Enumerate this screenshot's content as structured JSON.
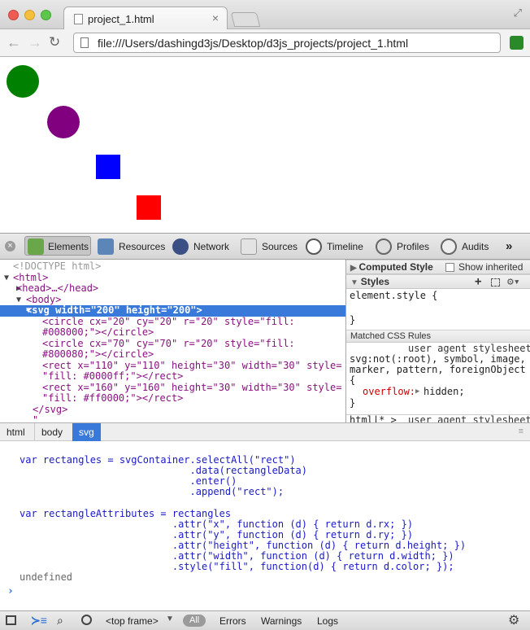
{
  "browser": {
    "tab_title": "project_1.html",
    "tab_close": "×",
    "url": "file:///Users/dashingd3js/Desktop/d3js_projects/project_1.html"
  },
  "page_shapes": [
    {
      "kind": "circle",
      "fill": "#008000"
    },
    {
      "kind": "circle",
      "fill": "#800080"
    },
    {
      "kind": "rect",
      "fill": "#0000ff"
    },
    {
      "kind": "rect",
      "fill": "#ff0000"
    }
  ],
  "devtools": {
    "tabs": [
      "Elements",
      "Resources",
      "Network",
      "Sources",
      "Timeline",
      "Profiles",
      "Audits"
    ],
    "more": "»",
    "elements_lines": [
      {
        "tri": "",
        "text": "<!DOCTYPE html>",
        "kind": "doctype"
      },
      {
        "tri": "▼",
        "text": "<html>",
        "kind": "tag"
      },
      {
        "tri": "▶",
        "text": "<head>…</head>",
        "kind": "tag"
      },
      {
        "tri": "▼",
        "text": "<body>",
        "kind": "tag"
      },
      {
        "tri": "▼",
        "text": "<svg width=\"200\" height=\"200\">",
        "kind": "selected"
      },
      {
        "tri": "",
        "text": "<circle cx=\"20\" cy=\"20\" r=\"20\" style=\"fill:",
        "kind": "tag"
      },
      {
        "tri": "",
        "text": "#008000;\"></circle>",
        "kind": "tag"
      },
      {
        "tri": "",
        "text": "<circle cx=\"70\" cy=\"70\" r=\"20\" style=\"fill:",
        "kind": "tag"
      },
      {
        "tri": "",
        "text": "#800080;\"></circle>",
        "kind": "tag"
      },
      {
        "tri": "",
        "text": "<rect x=\"110\" y=\"110\" height=\"30\" width=\"30\" style=",
        "kind": "tag"
      },
      {
        "tri": "",
        "text": "\"fill: #0000ff;\"></rect>",
        "kind": "tag"
      },
      {
        "tri": "",
        "text": "<rect x=\"160\" y=\"160\" height=\"30\" width=\"30\" style=",
        "kind": "tag"
      },
      {
        "tri": "",
        "text": "\"fill: #ff0000;\"></rect>",
        "kind": "tag"
      },
      {
        "tri": "",
        "text": "</svg>",
        "kind": "tag"
      },
      {
        "tri": "",
        "text": "\"",
        "kind": "tag"
      }
    ],
    "sidebar": {
      "computed_style": "Computed Style",
      "show_inherited": "Show inherited",
      "styles": "Styles",
      "element_style": "element.style {",
      "element_style_close": "}",
      "matched_rules": "Matched CSS Rules",
      "ua_stylesheet": "user agent stylesheet",
      "selector_1": "svg:not(:root), symbol, image,",
      "selector_2": "marker, pattern, foreignObject",
      "brace_open": "{",
      "overflow_prop": "overflow:",
      "overflow_val": "hidden;",
      "brace_close": "}",
      "next_rule": "html|* >",
      "next_rule_ua": "user agent stylesheet"
    },
    "breadcrumbs": [
      "html",
      "body",
      "svg"
    ],
    "console_lines": [
      {
        "text": "var rectangles = svgContainer.selectAll(\"rect\")",
        "type": "in"
      },
      {
        "text": "                             .data(rectangleData)",
        "type": "in"
      },
      {
        "text": "                             .enter()",
        "type": "in"
      },
      {
        "text": "                             .append(\"rect\");",
        "type": "in"
      },
      {
        "text": "",
        "type": "in"
      },
      {
        "text": "var rectangleAttributes = rectangles",
        "type": "in"
      },
      {
        "text": "                          .attr(\"x\", function (d) { return d.rx; })",
        "type": "in"
      },
      {
        "text": "                          .attr(\"y\", function (d) { return d.ry; })",
        "type": "in"
      },
      {
        "text": "                          .attr(\"height\", function (d) { return d.height; })",
        "type": "in"
      },
      {
        "text": "                          .attr(\"width\", function (d) { return d.width; })",
        "type": "in"
      },
      {
        "text": "                          .style(\"fill\", function(d) { return d.color; });",
        "type": "in"
      },
      {
        "text": "undefined",
        "type": "out"
      }
    ],
    "prompt": "›",
    "bottombar": {
      "frame": "<top frame>",
      "all": "All",
      "errors": "Errors",
      "warnings": "Warnings",
      "logs": "Logs"
    }
  }
}
